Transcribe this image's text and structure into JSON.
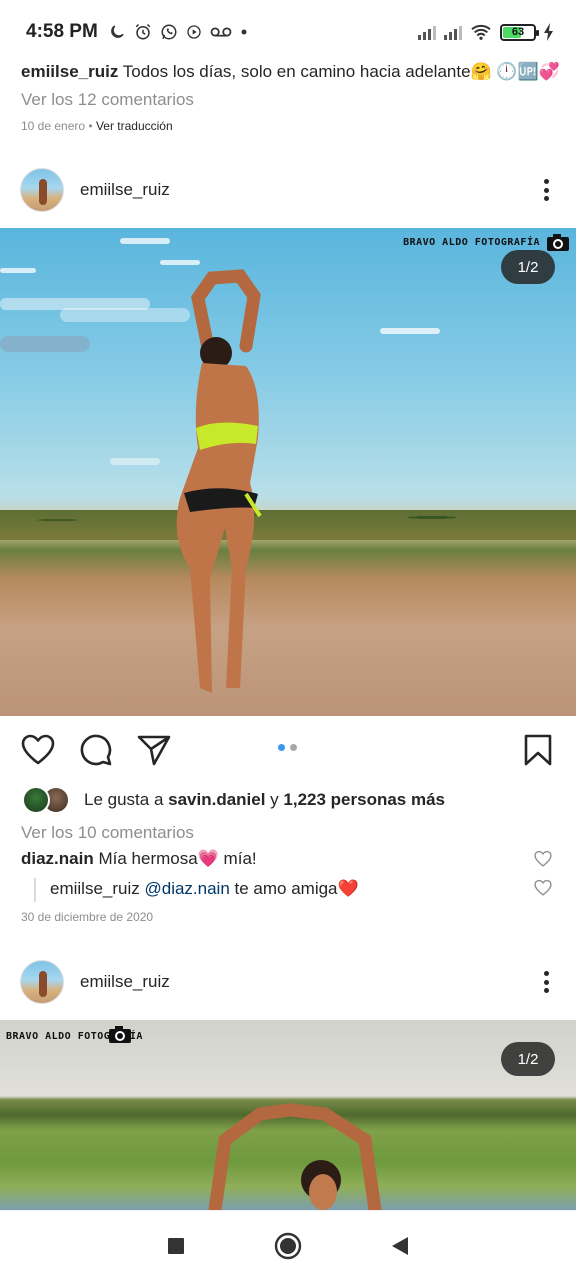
{
  "status_bar": {
    "time": "4:58 PM",
    "left_icons": [
      "moon-icon",
      "alarm-icon",
      "whatsapp-icon",
      "play-icon",
      "voicemail-icon",
      "dot-icon"
    ],
    "battery_level": "63",
    "battery_fraction": 0.63,
    "right_icons": [
      "signal-icon",
      "signal-icon",
      "wifi-icon",
      "battery-icon",
      "charging-icon"
    ]
  },
  "previous_post": {
    "username": "emiilse_ruiz",
    "caption": "Todos los días, solo en camino hacia adelante🤗 🕛🆙💞",
    "view_comments": "Ver los 12 comentarios",
    "date": "10 de enero",
    "separator": " • ",
    "translate": "Ver traducción"
  },
  "post": {
    "username": "emiilse_ruiz",
    "photo_credit": "BRAVO ALDO FOTOGRAFÍA",
    "counter": "1/2",
    "carousel_active_index": 0,
    "carousel_count": 2,
    "likes": {
      "prefix": "Le gusta a ",
      "user": "savin.daniel",
      "middle": " y ",
      "count": "1,223 personas más"
    },
    "view_comments": "Ver los 10 comentarios",
    "comments": [
      {
        "username": "diaz.nain",
        "text": "Mía hermosa💗 mía!"
      },
      {
        "username": "emiilse_ruiz",
        "mention": "@diaz.nain",
        "text": " te amo amiga❤️"
      }
    ],
    "date": "30 de diciembre de 2020"
  },
  "next_post": {
    "username": "emiilse_ruiz",
    "photo_credit": "BRAVO ALDO FOTOGRAFÍA",
    "counter": "1/2"
  },
  "colors": {
    "text": "#262626",
    "muted": "#8e8e8e",
    "mention": "#00376b",
    "dot_active": "#3897f0",
    "dot_inactive": "#a8a8a8"
  },
  "nav_bar": [
    "recents-square-icon",
    "home-circle-icon",
    "back-triangle-icon"
  ]
}
